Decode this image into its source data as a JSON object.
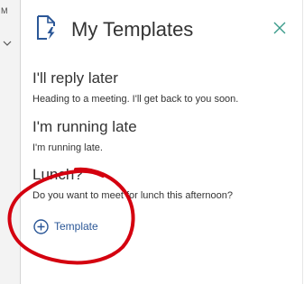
{
  "host": {
    "strip_letter": "M"
  },
  "pane": {
    "title": "My Templates",
    "accent_color": "#2b5797",
    "close_color": "#3a9b8b",
    "icons": {
      "app": "document-lightning-icon",
      "close": "close-icon",
      "add": "plus-circle-icon"
    }
  },
  "templates": [
    {
      "title": "I'll reply later",
      "body": "Heading to a meeting. I'll get back to you soon."
    },
    {
      "title": "I'm running late",
      "body": "I'm running late."
    },
    {
      "title": "Lunch?",
      "body": "Do you want to meet for lunch this afternoon?"
    }
  ],
  "actions": {
    "add_template_label": "Template"
  },
  "annotation": {
    "color": "#d4000f"
  }
}
